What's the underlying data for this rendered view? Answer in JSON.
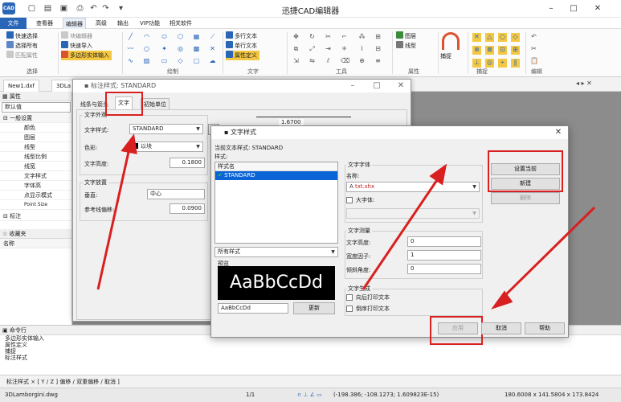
{
  "app": {
    "title": "迅捷CAD编辑器",
    "logo": "CAD"
  },
  "menu": [
    "文件",
    "查看器",
    "编辑器",
    "高级",
    "输出",
    "VIP功能",
    "相关软件"
  ],
  "ribbon": {
    "select": {
      "items": [
        "快速选择",
        "选择所有",
        "匹配属性"
      ],
      "label": "选择"
    },
    "edit_col": {
      "items": [
        "块编辑器",
        "快速导入",
        "多边形实体输入"
      ]
    },
    "draw_label": "绘制",
    "text": {
      "items": [
        "多行文本",
        "单行文本",
        "属性定义"
      ],
      "label": "文字"
    },
    "tools_label": "工具",
    "props": {
      "items": [
        "图层",
        "线型"
      ],
      "label": "属性"
    },
    "snap_label": "捕捉",
    "snap_button": "捕捉",
    "edit_label": "编辑"
  },
  "doc_tabs": [
    "New1.dxf",
    "3DLa"
  ],
  "properties": {
    "header": "属性",
    "default": "默认值",
    "group": "一般设置",
    "rows": [
      "颜色",
      "图层",
      "线型",
      "线型比例",
      "线宽",
      "文字样式",
      "字体高",
      "点显示模式",
      "Point Size"
    ],
    "group2": "标注"
  },
  "favorites": {
    "header": "收藏夹",
    "col": "名称"
  },
  "command": {
    "header": "命令行",
    "lines": [
      "多边形实体输入",
      "属性定义",
      "捕捉",
      "标注样式"
    ],
    "input": "标注样式 ×  [ Y / Z ]  偏移 / 双重偏移 / 取消 ]"
  },
  "status": {
    "file": "3DLamborgini.dwg",
    "page": "1/1",
    "coords": "(-198.386; -108.1273; 1.609823E-15)",
    "size": "180.6008 x 141.5804 x 173.8424"
  },
  "dim_dialog": {
    "title": "标注样式: STANDARD",
    "tabs": [
      "线条与箭头",
      "文字",
      "初始单位"
    ],
    "text_appearance": "文字外观",
    "text_style_label": "文字样式:",
    "text_style_value": "STANDARD",
    "color_label": "色彩:",
    "color_value": "以块",
    "height_label": "文字高度:",
    "height_value": "0.1800",
    "placement": "文字放置",
    "vertical_label": "垂直:",
    "vertical_value": "中心",
    "offset_label": "参考线偏移:",
    "offset_value": "0.0900",
    "preview_dim": "1.6700"
  },
  "text_dialog": {
    "title": "文字样式",
    "current_label": "当前文本样式:",
    "current_value": "STANDARD",
    "styles_label": "样式:",
    "list_header": "样式名",
    "styles": [
      "STANDARD"
    ],
    "filter_value": "所有样式",
    "preview_label": "预览",
    "preview_text": "AaBbCcDd",
    "preview_input": "AaBbCcDd",
    "update_button": "更新",
    "font_group": "文字字体",
    "name_label": "名称:",
    "font_value": "txt.shx",
    "bigfont_label": "大字体:",
    "measure_group": "文字测量",
    "height_label": "文字高度:",
    "height_value": "0",
    "width_label": "宽度因子:",
    "width_value": "1",
    "angle_label": "倾斜角度:",
    "angle_value": "0",
    "gen_group": "文字生成",
    "backward": "向后打印文本",
    "upside": "倒序打印文本",
    "set_current": "设置当前",
    "new": "新建",
    "delete": "删除",
    "apply": "应用",
    "cancel": "取消",
    "help": "帮助"
  },
  "colors": {
    "accent": "#2a66b8",
    "annotation_red": "#d92020",
    "preview_bg": "#000000",
    "selected": "#0a64d6"
  }
}
